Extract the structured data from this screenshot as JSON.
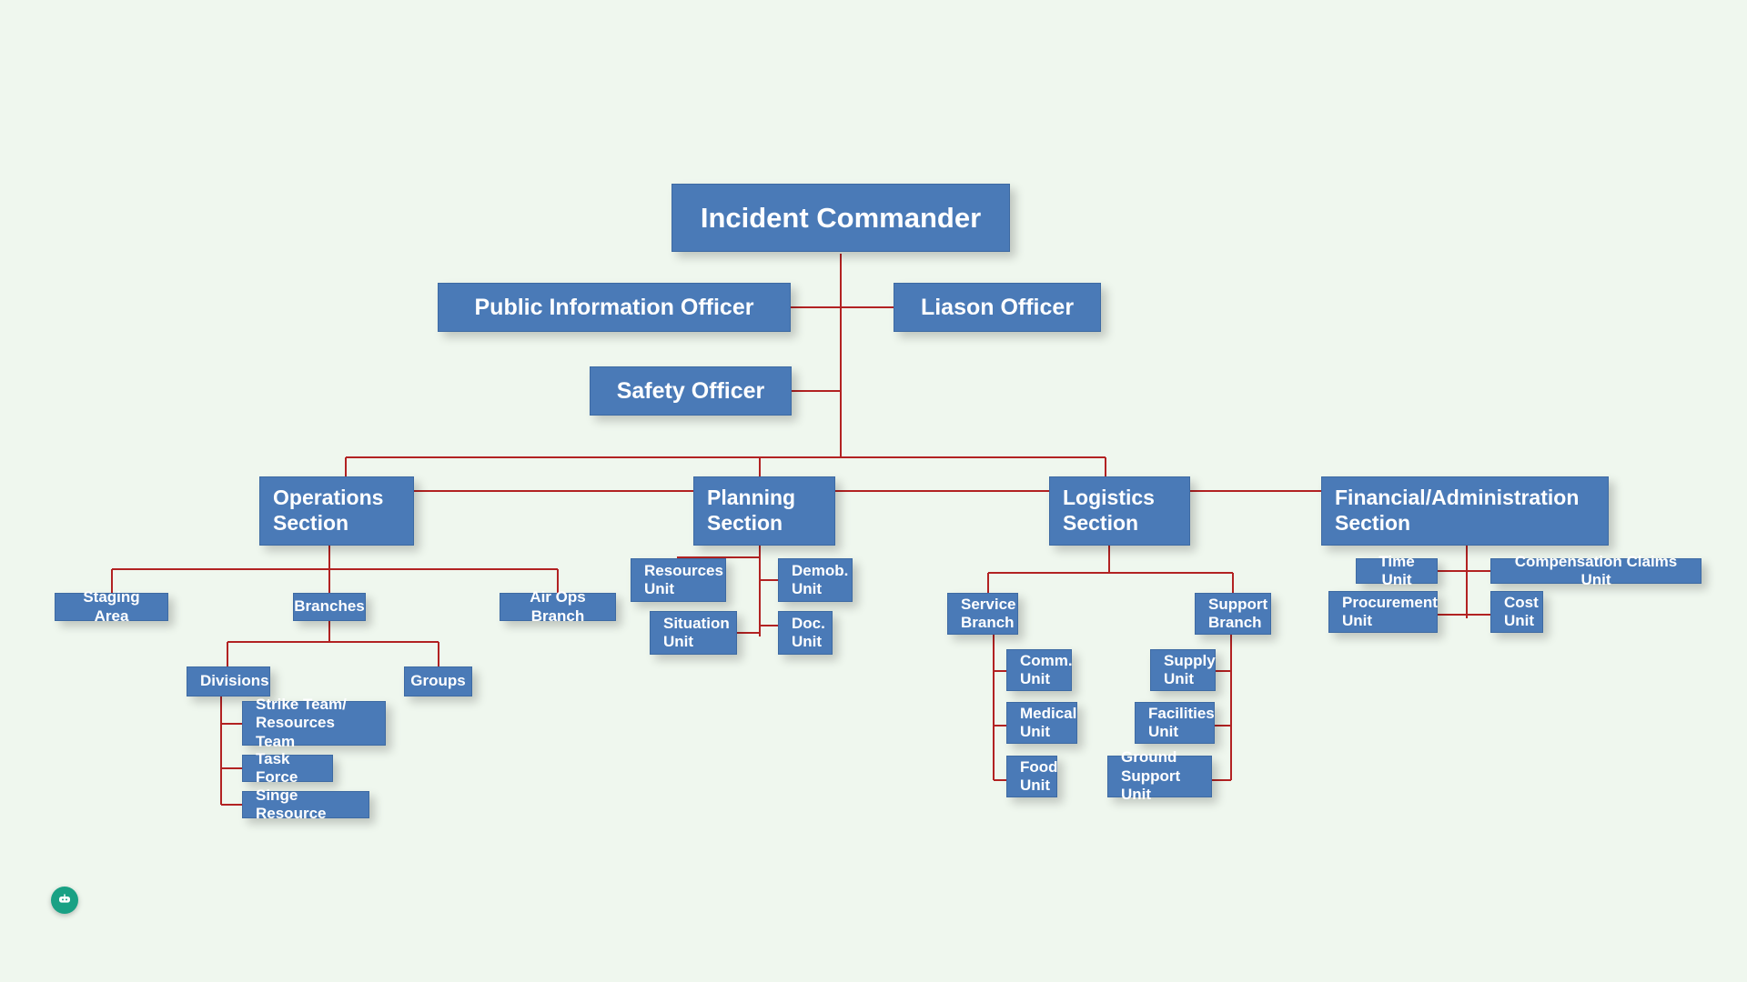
{
  "top": {
    "commander": "Incident Commander",
    "pio": "Public Information Officer",
    "liaison": "Liason Officer",
    "safety": "Safety Officer"
  },
  "sections": {
    "operations": "Operations\nSection",
    "planning": "Planning\nSection",
    "logistics": "Logistics\nSection",
    "finance": "Financial/Administration\nSection"
  },
  "ops": {
    "staging": "Staging Area",
    "branches": "Branches",
    "airops": "Air Ops Branch",
    "divisions": "Divisions",
    "groups": "Groups",
    "strike": "Strike Team/\nResources Team",
    "taskforce": "Task Force",
    "single": "Singe Resource"
  },
  "plan": {
    "resources": "Resources\nUnit",
    "demob": "Demob.\nUnit",
    "situation": "Situation\nUnit",
    "doc": "Doc.\nUnit"
  },
  "log": {
    "service": "Service\nBranch",
    "support": "Support\nBranch",
    "comm": "Comm.\nUnit",
    "medical": "Medical\nUnit",
    "food": "Food\nUnit",
    "supply": "Supply\nUnit",
    "facilities": "Facilities\nUnit",
    "ground": "Ground\nSupport Unit"
  },
  "fin": {
    "time": "Time Unit",
    "comp": "Compensation Claims Unit",
    "proc": "Procurement\nUnit",
    "cost": "Cost\nUnit"
  }
}
